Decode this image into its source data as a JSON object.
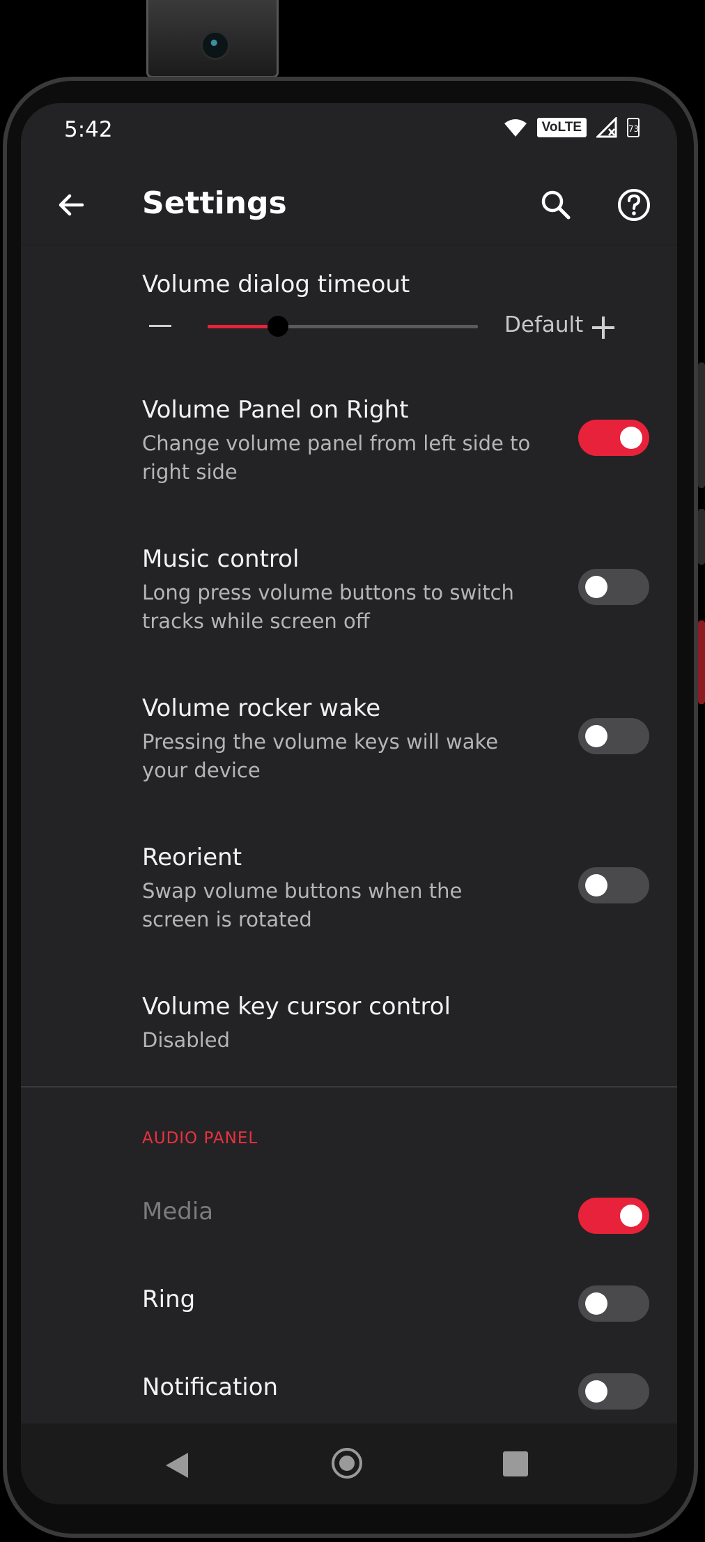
{
  "status_bar": {
    "time": "5:42",
    "network_badge": "VoLTE",
    "battery_level": "73",
    "icons": [
      "wifi-icon",
      "volte-icon",
      "signal-icon",
      "battery-icon"
    ]
  },
  "app_bar": {
    "title": "Settings",
    "icons": [
      "back-arrow-icon",
      "search-icon",
      "help-icon"
    ]
  },
  "volume_dialog_timeout": {
    "title": "Volume dialog timeout",
    "value_label": "Default",
    "level_fraction": 0.26
  },
  "settings": [
    {
      "title": "Volume Panel on Right",
      "subtitle": "Change volume panel from left side to right side",
      "enabled": true
    },
    {
      "title": "Music control",
      "subtitle": "Long press volume buttons to switch tracks while screen off",
      "enabled": false
    },
    {
      "title": "Volume rocker wake",
      "subtitle": "Pressing the volume keys will wake your device",
      "enabled": false
    },
    {
      "title": "Reorient",
      "subtitle": "Swap volume buttons when the screen is rotated",
      "enabled": false
    }
  ],
  "cursor_control": {
    "title": "Volume key cursor control",
    "value": "Disabled"
  },
  "audio_panel": {
    "header": "AUDIO PANEL",
    "items": [
      {
        "title": "Media",
        "enabled": true,
        "dimmed": true
      },
      {
        "title": "Ring",
        "enabled": false
      },
      {
        "title": "Notification",
        "enabled": false
      }
    ]
  },
  "colors": {
    "accent": "#e8223a",
    "background": "#232325",
    "toggle_off": "#4a4a4d"
  }
}
